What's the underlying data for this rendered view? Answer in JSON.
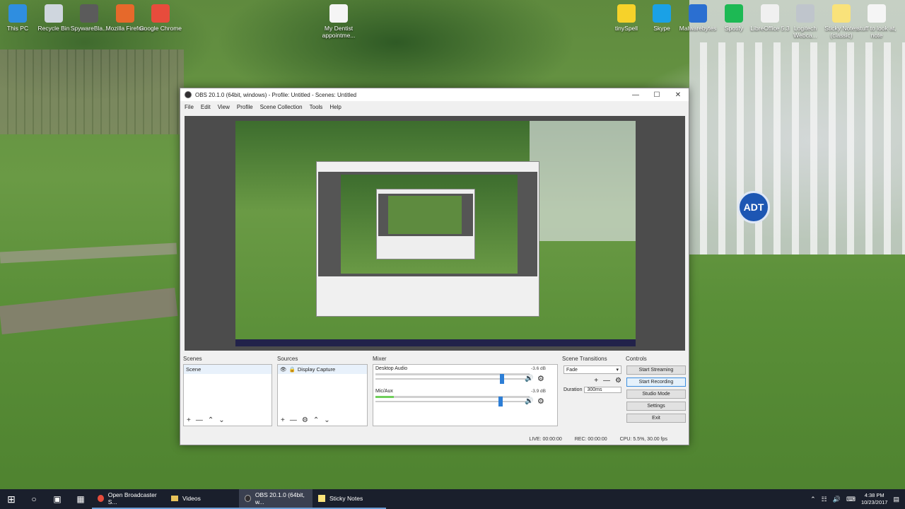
{
  "desktop": {
    "icons_left": [
      {
        "label": "This PC",
        "color": "#2f8ee0",
        "icon": "computer-icon"
      },
      {
        "label": "Recycle Bin",
        "color": "#cfd6de",
        "icon": "recycle-bin-icon"
      },
      {
        "label": "SpywareBla...",
        "color": "#5b5b5b",
        "icon": "spyware-icon"
      },
      {
        "label": "Mozilla Firefox",
        "color": "#e6692b",
        "icon": "firefox-icon"
      },
      {
        "label": "Google Chrome",
        "color": "#e74c3c",
        "icon": "chrome-icon"
      },
      {
        "label": "My Dentist appointme...",
        "color": "#f5f5f5",
        "icon": "document-icon"
      }
    ],
    "icons_right": [
      {
        "label": "tinySpell",
        "color": "#f6d22a",
        "icon": "tinyspell-icon"
      },
      {
        "label": "Skype",
        "color": "#1aa1e6",
        "icon": "skype-icon"
      },
      {
        "label": "Malwarebytes",
        "color": "#2b6fd1",
        "icon": "malwarebytes-icon"
      },
      {
        "label": "Spotify",
        "color": "#1db954",
        "icon": "spotify-icon"
      },
      {
        "label": "LibreOffice 5.3",
        "color": "#f0f0f0",
        "icon": "libreoffice-icon"
      },
      {
        "label": "Logitech Webca...",
        "color": "#bfc5cc",
        "icon": "webcam-icon"
      },
      {
        "label": "Sticky Notes (classic)",
        "color": "#f9e27a",
        "icon": "sticky-notes-icon"
      },
      {
        "label": "stuff to look at, note",
        "color": "#f5f5f5",
        "icon": "text-file-icon"
      }
    ],
    "adt": "ADT"
  },
  "obs": {
    "title": "OBS 20.1.0 (64bit, windows) - Profile: Untitled - Scenes: Untitled",
    "menu": [
      "File",
      "Edit",
      "View",
      "Profile",
      "Scene Collection",
      "Tools",
      "Help"
    ],
    "scenes": {
      "title": "Scenes",
      "items": [
        "Scene"
      ]
    },
    "sources": {
      "title": "Sources",
      "items": [
        "Display Capture"
      ]
    },
    "mixer": {
      "title": "Mixer",
      "channels": [
        {
          "name": "Desktop Audio",
          "db": "-3.6 dB",
          "meter": 0,
          "volume": 0.82
        },
        {
          "name": "Mic/Aux",
          "db": "-3.9 dB",
          "meter": 0.12,
          "volume": 0.81
        }
      ]
    },
    "transitions": {
      "title": "Scene Transitions",
      "selected": "Fade",
      "duration_label": "Duration",
      "duration_value": "300ms"
    },
    "controls": {
      "title": "Controls",
      "buttons": [
        "Start Streaming",
        "Start Recording",
        "Studio Mode",
        "Settings",
        "Exit"
      ]
    },
    "status": {
      "live": "LIVE: 00:00:00",
      "rec": "REC: 00:00:00",
      "cpu": "CPU: 5.5%, 30.00 fps"
    }
  },
  "taskbar": {
    "tasks": [
      {
        "label": "Open Broadcaster S...",
        "icon": "chrome-icon"
      },
      {
        "label": "Videos",
        "icon": "folder-icon"
      },
      {
        "label": "OBS 20.1.0 (64bit, w...",
        "icon": "obs-icon"
      },
      {
        "label": "Sticky Notes",
        "icon": "sticky-notes-icon"
      }
    ],
    "time": "4:38 PM",
    "date": "10/23/2017"
  }
}
